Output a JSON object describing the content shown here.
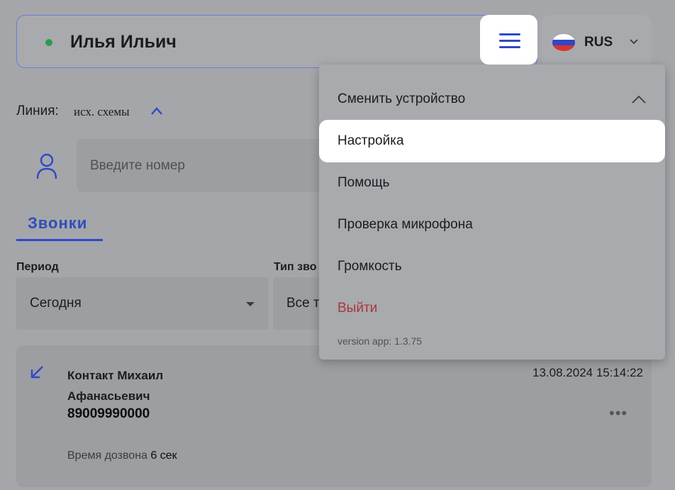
{
  "user": {
    "name": "Илья Ильич",
    "status_color": "#2b9c48"
  },
  "language": {
    "selected": "RUS",
    "flag_colors": [
      "#ffffff",
      "#3346c4",
      "#d8342e"
    ]
  },
  "line": {
    "label": "Линия:",
    "value": "исх. схемы"
  },
  "search": {
    "placeholder": "Введите номер"
  },
  "tabs": [
    {
      "label": "Звонки",
      "active": true
    }
  ],
  "filters": {
    "period_label": "Период",
    "period_value": "Сегодня",
    "type_label": "Тип зво",
    "type_value": "Все т"
  },
  "call": {
    "name": "Контакт Михаил Афанасьевич",
    "number": "89009990000",
    "datetime": "13.08.2024 15:14:22",
    "duration_label": "Время дозвона",
    "duration_value": "6 сек",
    "direction": "incoming"
  },
  "menu": {
    "items": [
      {
        "label": "Сменить устройство",
        "expanded": true
      },
      {
        "label": "Настройка",
        "active": true
      },
      {
        "label": "Помощь"
      },
      {
        "label": "Проверка микрофона"
      },
      {
        "label": "Громкость"
      },
      {
        "label": "Выйти",
        "color": "#a8383f"
      }
    ],
    "version": "version app: 1.3.75"
  },
  "colors": {
    "accent": "#2f49c7",
    "highlight": "#ffffff"
  }
}
